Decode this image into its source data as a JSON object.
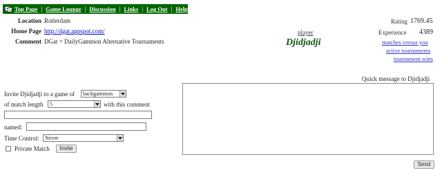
{
  "nav": {
    "items": [
      "Top Page",
      "Game Lounge",
      "Discussion",
      "Links",
      "Log Out",
      "Help"
    ]
  },
  "profile": {
    "location_label": "Location",
    "location_value": "Rotterdam",
    "homepage_label": "Home Page",
    "homepage_value": "http://dgat.appspot.com/",
    "comment_label": "Comment",
    "comment_value": "DGat = DailyGammon Alternative Tournaments"
  },
  "player": {
    "caption": "player",
    "name": "Djidjadji"
  },
  "stats": {
    "rating_label": "Rating",
    "rating_value": "1769.45",
    "experience_label": "Experience",
    "experience_value": "4389"
  },
  "links": {
    "matches_vs_you": "matches versus you",
    "active_tournaments": "active tournaments",
    "tournament_wins": "tournament wins"
  },
  "invite": {
    "prefix": "Invite Djidjadji to a game of",
    "game_select": "backgammon",
    "match_length_label": "of match length",
    "match_length_select": "5",
    "comment_label": "with this comment",
    "named_label": "named:",
    "time_control_label": "Time Control:",
    "time_control_select": "Never",
    "private_match_label": "Private Match",
    "invite_button": "Invite"
  },
  "quick_message": {
    "label": "Quick message to Djidjadji",
    "send_button": "Send"
  },
  "colors": {
    "nav_bg": "#006600",
    "player_name": "#115511",
    "link": "#0000cc"
  }
}
